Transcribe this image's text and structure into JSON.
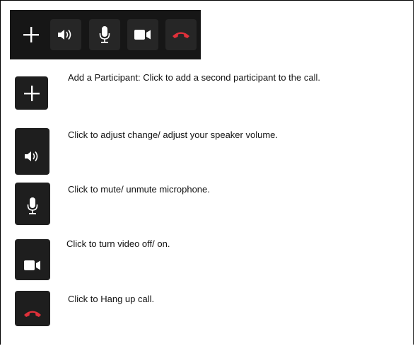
{
  "toolbar": {
    "buttons": [
      {
        "id": "add",
        "icon": "plus-icon"
      },
      {
        "id": "speaker",
        "icon": "speaker-icon"
      },
      {
        "id": "mic",
        "icon": "microphone-icon"
      },
      {
        "id": "video",
        "icon": "video-camera-icon"
      },
      {
        "id": "hangup",
        "icon": "hang-up-phone-icon"
      }
    ]
  },
  "legend": {
    "items": [
      {
        "icon": "plus-icon",
        "text": "Add a Participant: Click to add a second participant to the call."
      },
      {
        "icon": "speaker-icon",
        "text": "Click to adjust change/ adjust your speaker volume."
      },
      {
        "icon": "microphone-icon",
        "text": "Click to mute/ unmute microphone."
      },
      {
        "icon": "video-camera-icon",
        "text": "Click to turn video off/ on."
      },
      {
        "icon": "hang-up-phone-icon",
        "text": "Click to Hang up call."
      }
    ]
  },
  "colors": {
    "toolbar_bg": "#161616",
    "button_bg": "#262626",
    "icon_white": "#ffffff",
    "hangup_red": "#e0303a"
  }
}
